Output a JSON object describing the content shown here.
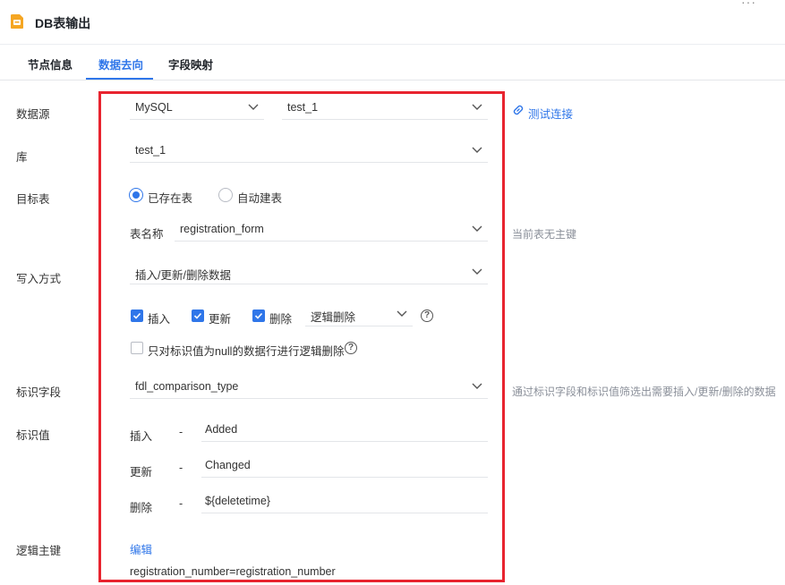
{
  "header": {
    "title": "DB表输出",
    "more": "···"
  },
  "tabs": [
    {
      "label": "节点信息"
    },
    {
      "label": "数据去向"
    },
    {
      "label": "字段映射"
    }
  ],
  "form": {
    "datasource": {
      "label": "数据源",
      "type_value": "MySQL",
      "conn_value": "test_1",
      "test_link": "测试连接"
    },
    "database": {
      "label": "库",
      "value": "test_1"
    },
    "target_table": {
      "label": "目标表",
      "radio_existing": "已存在表",
      "radio_auto": "自动建表",
      "table_name_label": "表名称",
      "table_name_value": "registration_form",
      "hint": "当前表无主键"
    },
    "write_mode": {
      "label": "写入方式",
      "value": "插入/更新/删除数据",
      "insert_label": "插入",
      "update_label": "更新",
      "delete_label": "删除",
      "delete_mode_value": "逻辑删除",
      "null_only_label": "只对标识值为null的数据行进行逻辑删除"
    },
    "flag_field": {
      "label": "标识字段",
      "value": "fdl_comparison_type",
      "hint": "通过标识字段和标识值筛选出需要插入/更新/删除的数据"
    },
    "flag_values": {
      "label": "标识值",
      "dash": "-",
      "insert_label": "插入",
      "insert_value": "Added",
      "update_label": "更新",
      "update_value": "Changed",
      "delete_label": "删除",
      "delete_value": "${deletetime}"
    },
    "logic_key": {
      "label": "逻辑主键",
      "edit_link": "编辑",
      "mapping": "registration_number=registration_number"
    }
  },
  "colors": {
    "accent": "#2f76e9",
    "highlight": "#e8242f"
  }
}
